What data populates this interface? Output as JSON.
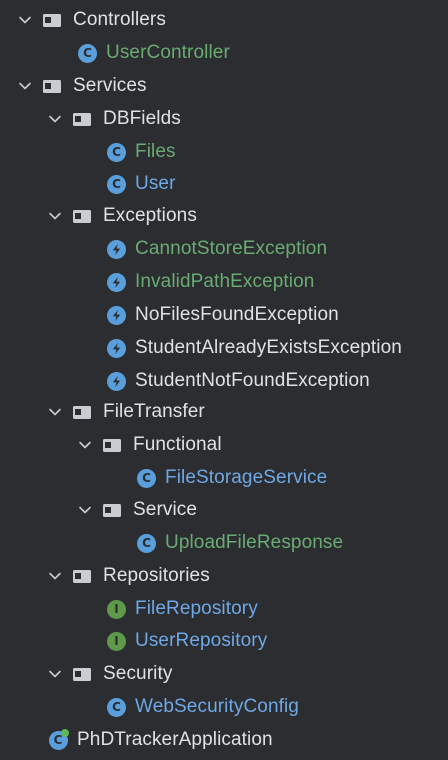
{
  "tree": {
    "controllers": {
      "label": "Controllers",
      "children": [
        {
          "label": "UserController",
          "kind": "class",
          "color": "green"
        }
      ]
    },
    "services": {
      "label": "Services",
      "dbfields": {
        "label": "DBFields",
        "children": [
          {
            "label": "Files",
            "kind": "class",
            "color": "green"
          },
          {
            "label": "User",
            "kind": "class",
            "color": "blue"
          }
        ]
      },
      "exceptions": {
        "label": "Exceptions",
        "children": [
          {
            "label": "CannotStoreException",
            "kind": "exception",
            "color": "green"
          },
          {
            "label": "InvalidPathException",
            "kind": "exception",
            "color": "green"
          },
          {
            "label": "NoFilesFoundException",
            "kind": "exception",
            "color": "white"
          },
          {
            "label": "StudentAlreadyExistsException",
            "kind": "exception",
            "color": "white"
          },
          {
            "label": "StudentNotFoundException",
            "kind": "exception",
            "color": "white"
          }
        ]
      },
      "filetransfer": {
        "label": "FileTransfer",
        "functional": {
          "label": "Functional",
          "children": [
            {
              "label": "FileStorageService",
              "kind": "class",
              "color": "blue"
            }
          ]
        },
        "service": {
          "label": "Service",
          "children": [
            {
              "label": "UploadFileResponse",
              "kind": "class",
              "color": "green"
            }
          ]
        }
      },
      "repositories": {
        "label": "Repositories",
        "children": [
          {
            "label": "FileRepository",
            "kind": "interface",
            "color": "blue"
          },
          {
            "label": "UserRepository",
            "kind": "interface",
            "color": "blue"
          }
        ]
      },
      "security": {
        "label": "Security",
        "children": [
          {
            "label": "WebSecurityConfig",
            "kind": "class",
            "color": "blue"
          }
        ]
      }
    },
    "app": {
      "label": "PhDTrackerApplication",
      "kind": "spring-boot-class",
      "color": "white"
    }
  },
  "colors": {
    "background": "#2b2d30",
    "text_default": "#dfe1e5",
    "text_green": "#6aab73",
    "text_blue": "#6fa8e6",
    "class_icon": "#5a9fdc",
    "interface_icon": "#5f9a4b"
  },
  "icons": {
    "class_glyph": "C",
    "interface_glyph": "I"
  }
}
